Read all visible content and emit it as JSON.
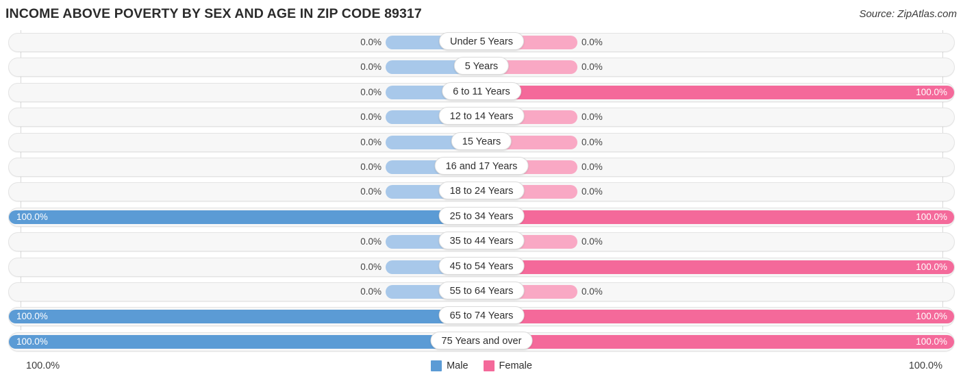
{
  "header": {
    "title": "INCOME ABOVE POVERTY BY SEX AND AGE IN ZIP CODE 89317",
    "source": "Source: ZipAtlas.com"
  },
  "legend": {
    "male_label": "Male",
    "female_label": "Female",
    "male_color": "#5b9bd5",
    "female_color": "#f4699a"
  },
  "axis": {
    "left_label": "100.0%",
    "right_label": "100.0%"
  },
  "chart_data": {
    "type": "bar",
    "title": "INCOME ABOVE POVERTY BY SEX AND AGE IN ZIP CODE 89317",
    "subtitle": "Source: ZipAtlas.com",
    "orientation": "horizontal-diverging",
    "xlabel": "",
    "ylabel": "",
    "xlim": [
      0,
      100
    ],
    "grid": false,
    "legend_position": "bottom-center",
    "categories": [
      "Under 5 Years",
      "5 Years",
      "6 to 11 Years",
      "12 to 14 Years",
      "15 Years",
      "16 and 17 Years",
      "18 to 24 Years",
      "25 to 34 Years",
      "35 to 44 Years",
      "45 to 54 Years",
      "55 to 64 Years",
      "65 to 74 Years",
      "75 Years and over"
    ],
    "series": [
      {
        "name": "Male",
        "color": "#5b9bd5",
        "values": [
          0.0,
          0.0,
          0.0,
          0.0,
          0.0,
          0.0,
          0.0,
          100.0,
          0.0,
          0.0,
          0.0,
          100.0,
          100.0
        ],
        "labels": [
          "0.0%",
          "0.0%",
          "0.0%",
          "0.0%",
          "0.0%",
          "0.0%",
          "0.0%",
          "100.0%",
          "0.0%",
          "0.0%",
          "0.0%",
          "100.0%",
          "100.0%"
        ]
      },
      {
        "name": "Female",
        "color": "#f4699a",
        "values": [
          0.0,
          0.0,
          100.0,
          0.0,
          0.0,
          0.0,
          0.0,
          100.0,
          0.0,
          100.0,
          0.0,
          100.0,
          100.0
        ],
        "labels": [
          "0.0%",
          "0.0%",
          "100.0%",
          "0.0%",
          "0.0%",
          "0.0%",
          "0.0%",
          "100.0%",
          "0.0%",
          "100.0%",
          "0.0%",
          "100.0%",
          "100.0%"
        ]
      }
    ]
  }
}
